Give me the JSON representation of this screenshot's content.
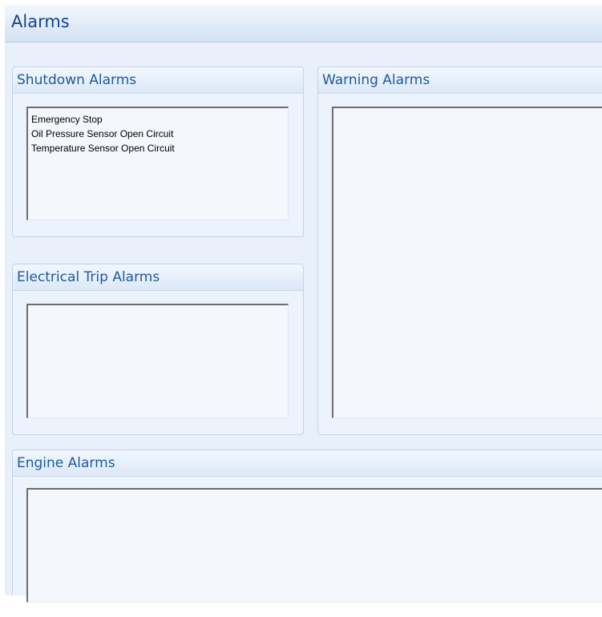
{
  "window": {
    "title": "Alarms"
  },
  "groups": {
    "shutdown": {
      "title": "Shutdown Alarms",
      "items": [
        "Emergency Stop",
        "Oil Pressure Sensor Open Circuit",
        "Temperature Sensor Open Circuit"
      ]
    },
    "warning": {
      "title": "Warning Alarms",
      "items": []
    },
    "electrical_trip": {
      "title": "Electrical Trip Alarms",
      "items": []
    },
    "engine": {
      "title": "Engine Alarms",
      "items": []
    }
  },
  "colors": {
    "header_text": "#15428b",
    "group_title_text": "#1e5a9c",
    "panel_background": "#e9f0fa"
  }
}
